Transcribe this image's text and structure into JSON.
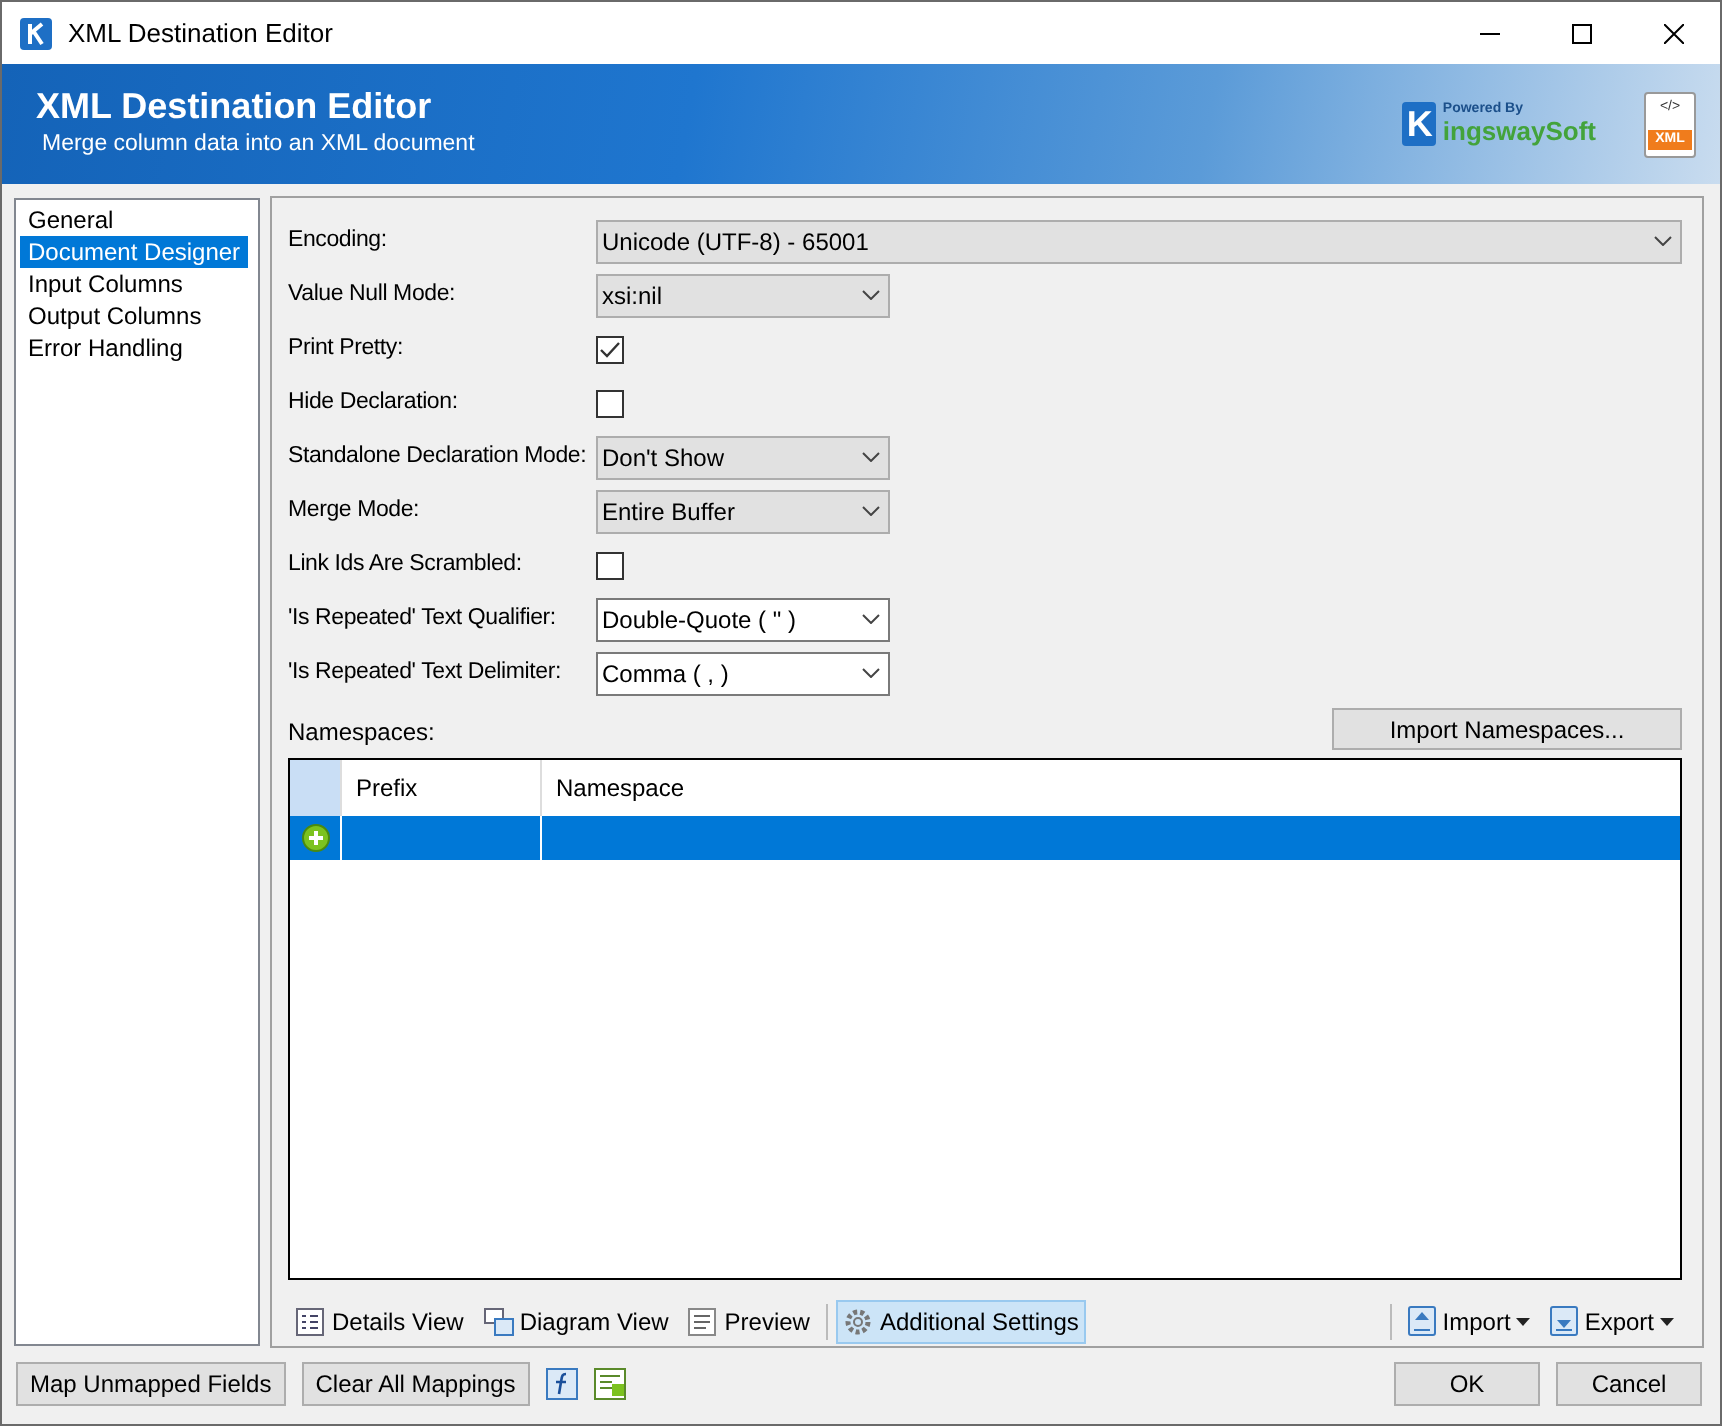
{
  "window": {
    "title": "XML Destination Editor"
  },
  "header": {
    "title": "XML Destination Editor",
    "subtitle": "Merge column data into an XML document",
    "logo": {
      "initial": "K",
      "tagline": "Powered By",
      "name": "ingswaySoft"
    },
    "file_icon": {
      "code": "</>",
      "label": "XML"
    }
  },
  "sidebar": {
    "items": [
      {
        "label": "General",
        "selected": false
      },
      {
        "label": "Document Designer",
        "selected": true
      },
      {
        "label": "Input Columns",
        "selected": false
      },
      {
        "label": "Output Columns",
        "selected": false
      },
      {
        "label": "Error Handling",
        "selected": false
      }
    ]
  },
  "fields": [
    {
      "kind": "select",
      "label": "Encoding:",
      "value": "Unicode (UTF-8) - 65001",
      "editable": false,
      "wide": true
    },
    {
      "kind": "select",
      "label": "Value Null Mode:",
      "value": "xsi:nil",
      "editable": false,
      "wide": false
    },
    {
      "kind": "checkbox",
      "label": "Print Pretty:",
      "checked": true
    },
    {
      "kind": "checkbox",
      "label": "Hide Declaration:",
      "checked": false
    },
    {
      "kind": "select",
      "label": "Standalone Declaration Mode:",
      "value": "Don't Show",
      "editable": false,
      "wide": false
    },
    {
      "kind": "select",
      "label": "Merge Mode:",
      "value": "Entire Buffer",
      "editable": false,
      "wide": false
    },
    {
      "kind": "checkbox",
      "label": "Link Ids Are Scrambled:",
      "checked": false
    },
    {
      "kind": "select",
      "label": "'Is Repeated' Text Qualifier:",
      "value": "Double-Quote ( \" )",
      "editable": true,
      "wide": false
    },
    {
      "kind": "select",
      "label": "'Is Repeated' Text Delimiter:",
      "value": "Comma ( , )",
      "editable": true,
      "wide": false
    }
  ],
  "namespaces": {
    "label": "Namespaces:",
    "import_button": "Import Namespaces...",
    "columns": [
      "Prefix",
      "Namespace"
    ],
    "rows": [
      {
        "selected": true
      }
    ]
  },
  "view_tabs": [
    {
      "label": "Details View",
      "selected": false
    },
    {
      "label": "Diagram View",
      "selected": false
    },
    {
      "label": "Preview",
      "selected": false
    },
    {
      "label": "Additional Settings",
      "selected": true
    }
  ],
  "menus": [
    "Import",
    "Export"
  ],
  "footer": {
    "left_buttons": [
      "Map Unmapped Fields",
      "Clear All Mappings"
    ],
    "right_buttons": [
      "OK",
      "Cancel"
    ]
  }
}
